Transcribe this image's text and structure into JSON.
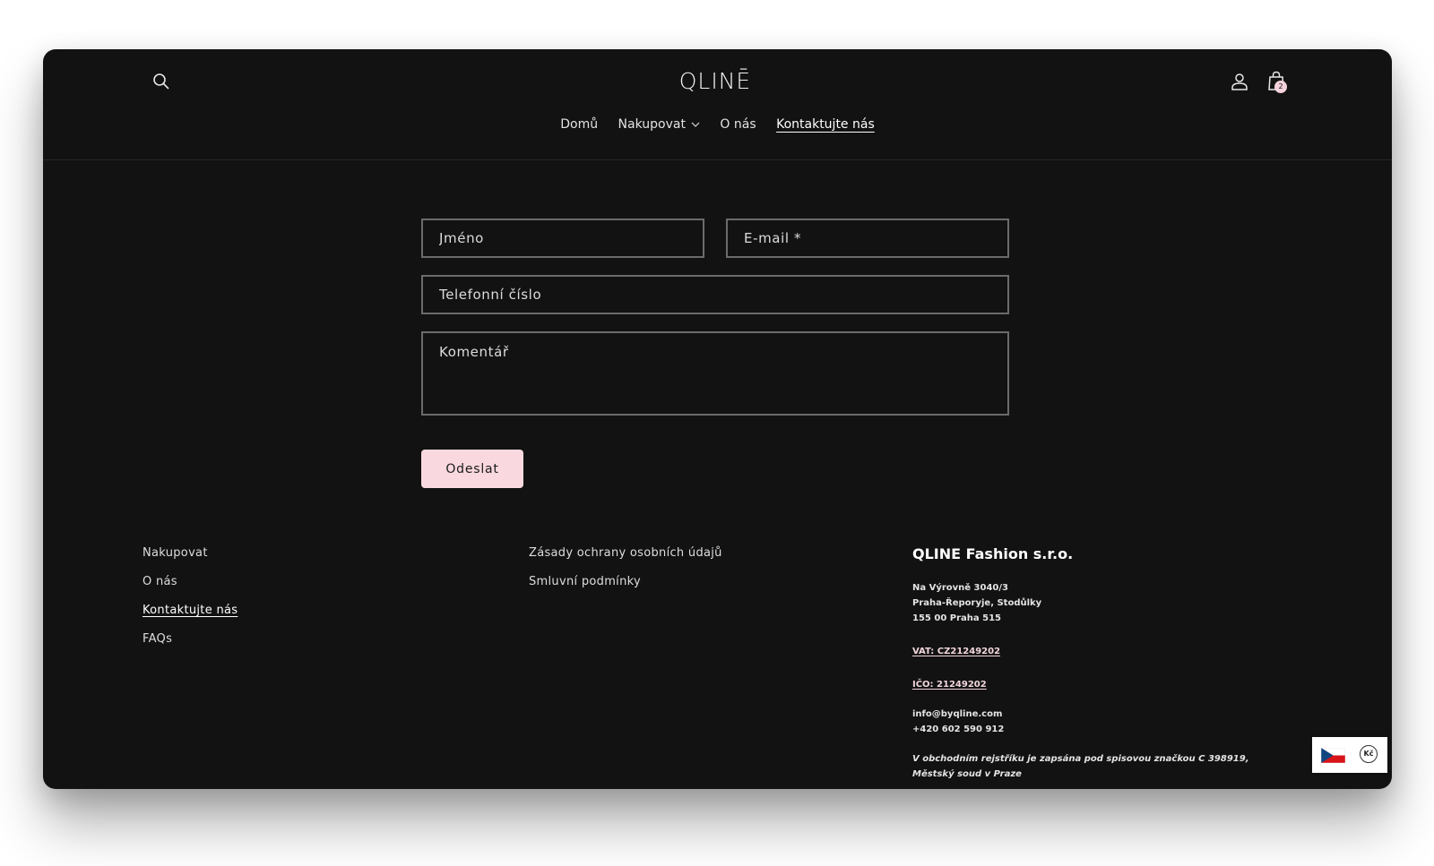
{
  "brand": {
    "logo_text": "QLINĒ"
  },
  "header": {
    "nav": [
      {
        "label": "Domů",
        "active": false
      },
      {
        "label": "Nakupovat",
        "active": false,
        "has_dropdown": true
      },
      {
        "label": "O nás",
        "active": false
      },
      {
        "label": "Kontaktujte nás",
        "active": true
      }
    ],
    "cart_count": "2",
    "icons": [
      "search-icon",
      "account-icon",
      "cart-icon"
    ]
  },
  "form": {
    "name_placeholder": "Jméno",
    "email_placeholder": "E-mail *",
    "phone_placeholder": "Telefonní číslo",
    "comment_placeholder": "Komentář",
    "submit_label": "Odeslat"
  },
  "footer": {
    "col1": [
      {
        "label": "Nakupovat",
        "active": false
      },
      {
        "label": "O nás",
        "active": false
      },
      {
        "label": "Kontaktujte nás",
        "active": true
      },
      {
        "label": "FAQs",
        "active": false
      }
    ],
    "col2": [
      {
        "label": "Zásady ochrany osobních údajů"
      },
      {
        "label": "Smluvní podmínky"
      }
    ],
    "company": {
      "name": "QLINE Fashion s.r.o.",
      "address_line1": "Na Výrovně 3040/3",
      "address_line2": "Praha-Řeporyje, Stodůlky",
      "address_line3": "155 00 Praha 515",
      "vat": "VAT: CZ21249202",
      "ico": "IČO: 21249202",
      "email": "info@byqline.com",
      "phone": "+420 602 590 912",
      "register_note_line1": "V obchodním rejstříku je zapsána pod spisovou značkou C 398919,",
      "register_note_line2": "Městský soud v Praze"
    }
  },
  "currency_widget": {
    "currency_symbol": "Kč",
    "flag": "czech-flag"
  },
  "colors": {
    "background": "#121212",
    "accent": "#f9d8df",
    "text": "#e9e9e9"
  }
}
